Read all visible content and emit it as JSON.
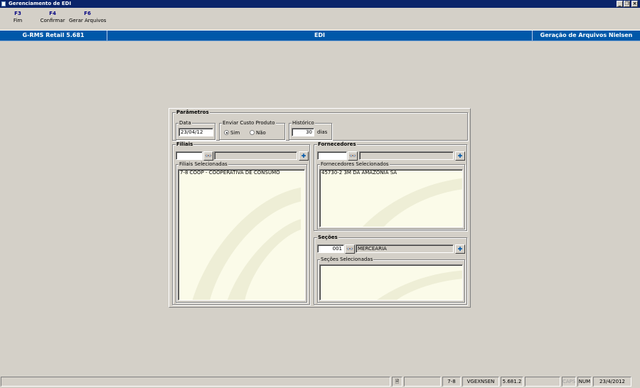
{
  "window": {
    "title": "Gerenciamento de EDI",
    "controls": {
      "minimize": "_",
      "restore": "❐",
      "close": "×"
    }
  },
  "toolbar": [
    {
      "key": "F3",
      "label": "Fim"
    },
    {
      "key": "F4",
      "label": "Confirmar"
    },
    {
      "key": "F6",
      "label": "Gerar Arquivos"
    }
  ],
  "header": {
    "app": "G-RMS Retail 5.681",
    "module": "EDI",
    "function": "Geração de Arquivos Nielsen"
  },
  "parametros": {
    "title": "Parâmetros",
    "data": {
      "label": "Data",
      "value": "23/04/12"
    },
    "enviar_custo": {
      "label": "Enviar Custo Produto",
      "options": [
        "Sim",
        "Não"
      ],
      "selected": "Sim"
    },
    "historico": {
      "label": "Histórico",
      "value": "30",
      "unit": "dias"
    }
  },
  "filiais": {
    "title": "Filiais",
    "code_value": "",
    "desc_value": "",
    "list_label": "Filiais Selecionadas",
    "items": [
      "7-8 COOP - COOPERATIVA DE CONSUMO"
    ]
  },
  "fornecedores": {
    "title": "Fornecedores",
    "code_value": "",
    "desc_value": "",
    "list_label": "Fornecedores Selecionados",
    "items": [
      "45730-2 3M DA AMAZONIA SA"
    ]
  },
  "secoes": {
    "title": "Seções",
    "code_value": "001",
    "desc_value": "MERCEARIA",
    "list_label": "Seções Selecionadas",
    "items": []
  },
  "statusbar": {
    "filial": "7-8",
    "program": "VGEXNSEN",
    "version": "5.681.2",
    "caps": "CAPS",
    "num": "NUM",
    "date": "23/4/2012"
  },
  "icons": {
    "search": "binoculars-icon",
    "add": "add-selection-icon",
    "status": "document-icon"
  },
  "colors": {
    "titlebar": "#0a246a",
    "header": "#0058a9",
    "list_bg": "#fbfbe9",
    "face": "#d4d0c8"
  }
}
